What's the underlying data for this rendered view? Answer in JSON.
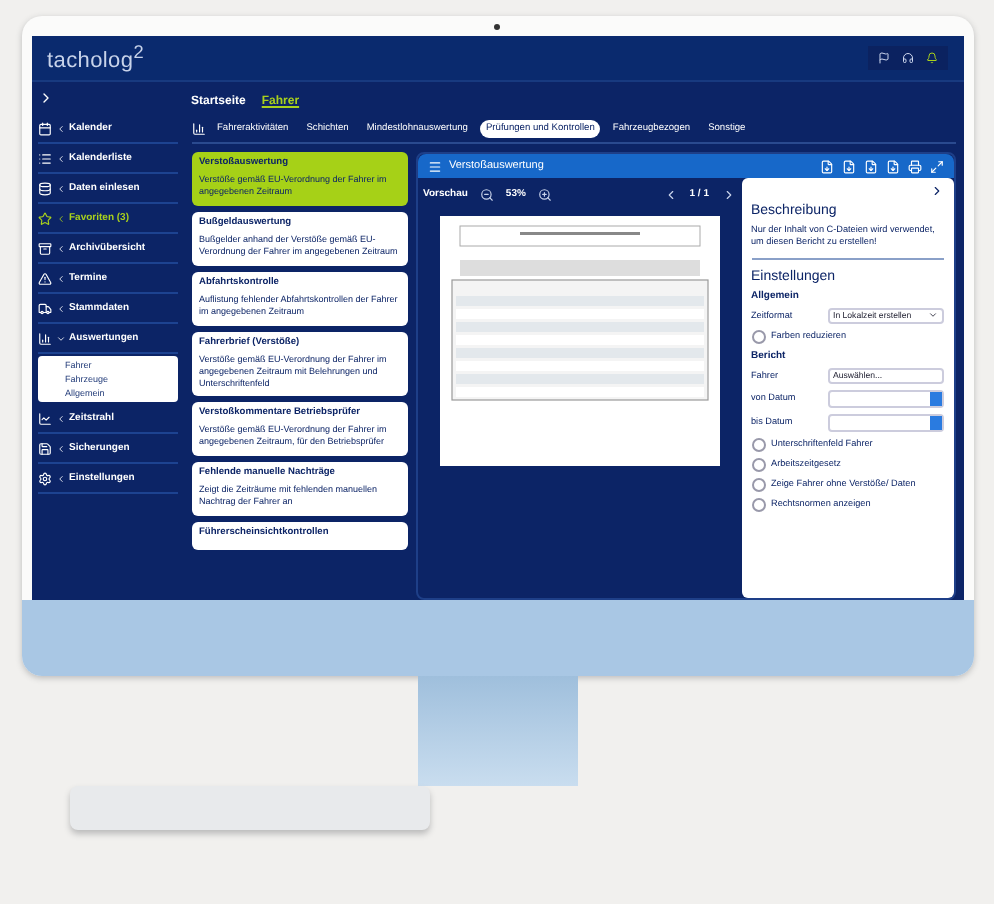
{
  "header": {
    "logo": "tacholog$^{2}$"
  },
  "sidebar": {
    "items": [
      {
        "label": "Kalender",
        "highlighted": false
      },
      {
        "label": "Kalenderliste",
        "highlighted": false
      },
      {
        "label": "Daten einlesen",
        "highlighted": false
      },
      {
        "label": "Favoriten (3)",
        "highlighted": true
      },
      {
        "label": "Archivübersicht",
        "highlighted": false
      },
      {
        "label": "Termine",
        "highlighted": false
      },
      {
        "label": "Stammdaten",
        "highlighted": false
      },
      {
        "label": "Auswertungen",
        "highlighted": false,
        "expanded": true,
        "children": [
          {
            "label": "Fahrer"
          },
          {
            "label": "Fahrzeuge"
          },
          {
            "label": "Allgemein"
          }
        ]
      },
      {
        "label": "Zeitstrahl",
        "highlighted": false
      },
      {
        "label": "Sicherungen",
        "highlighted": false
      },
      {
        "label": "Einstellungen",
        "highlighted": false
      }
    ]
  },
  "breadcrumb": [
    "Startseite",
    "Fahrer"
  ],
  "tabs": [
    {
      "label": "Fahreraktivitäten",
      "selected": false
    },
    {
      "label": "Schichten",
      "selected": false
    },
    {
      "label": "Mindestlohnauswertung",
      "selected": false
    },
    {
      "label": "Prüfungen und Kontrollen",
      "selected": true
    },
    {
      "label": "Fahrzeugbezogen",
      "selected": false
    },
    {
      "label": "Sonstige",
      "selected": false
    }
  ],
  "reports": [
    {
      "title": "Verstoßauswertung",
      "text": "Verstöße gemäß EU-Verordnung der Fahrer im angegebenen Zeitraum",
      "selected": true
    },
    {
      "title": "Bußgeldauswertung",
      "text": "Bußgelder anhand der Verstöße gemäß EU-Verordnung der Fahrer im angegebenen Zeitraum",
      "selected": false
    },
    {
      "title": "Abfahrtskontrolle",
      "text": "Auflistung fehlender Abfahrtskontrollen der Fahrer im angegebenen Zeitraum",
      "selected": false
    },
    {
      "title": "Fahrerbrief (Verstöße)",
      "text": "Verstöße gemäß EU-Verordnung der Fahrer im angegebenen Zeitraum mit Belehrungen und Unterschriftenfeld",
      "selected": false
    },
    {
      "title": "Verstoßkommentare Betriebsprüfer",
      "text": "Verstöße gemäß EU-Verordnung der Fahrer im angegebenen Zeitraum, für den Betriebsprüfer",
      "selected": false
    },
    {
      "title": "Fehlende manuelle Nachträge",
      "text": "Zeigt die Zeiträume mit fehlenden manuellen Nachtrag der Fahrer an",
      "selected": false
    },
    {
      "title": "Führerscheinsichtkontrollen",
      "selected": false
    }
  ],
  "viewer": {
    "title": "Verstoßauswertung",
    "preview_label": "Vorschau",
    "zoom": "53%",
    "page": "1 / 1"
  },
  "settings": {
    "description_title": "Beschreibung",
    "description": "Nur der Inhalt von C-Dateien wird verwendet, um diesen Bericht zu erstellen!",
    "title": "Einstellungen",
    "general": "Allgemein",
    "time_format_label": "Zeitformat",
    "time_format": "In Lokalzeit erstellen",
    "report": "Bericht",
    "driver_label": "Fahrer",
    "driver": "Auswählen...",
    "from_label": "von Datum",
    "to_label": "bis Datum",
    "general_options": [
      {
        "label": "Farben reduzieren",
        "checked": false
      }
    ],
    "report_options": [
      {
        "label": "Unterschriftenfeld Fahrer",
        "checked": false
      },
      {
        "label": "Arbeitszeitgesetz",
        "checked": false
      },
      {
        "label": "Zeige Fahrer ohne Verstöße/ Daten",
        "checked": false
      },
      {
        "label": "Rechtsnormen anzeigen",
        "checked": false
      }
    ]
  }
}
